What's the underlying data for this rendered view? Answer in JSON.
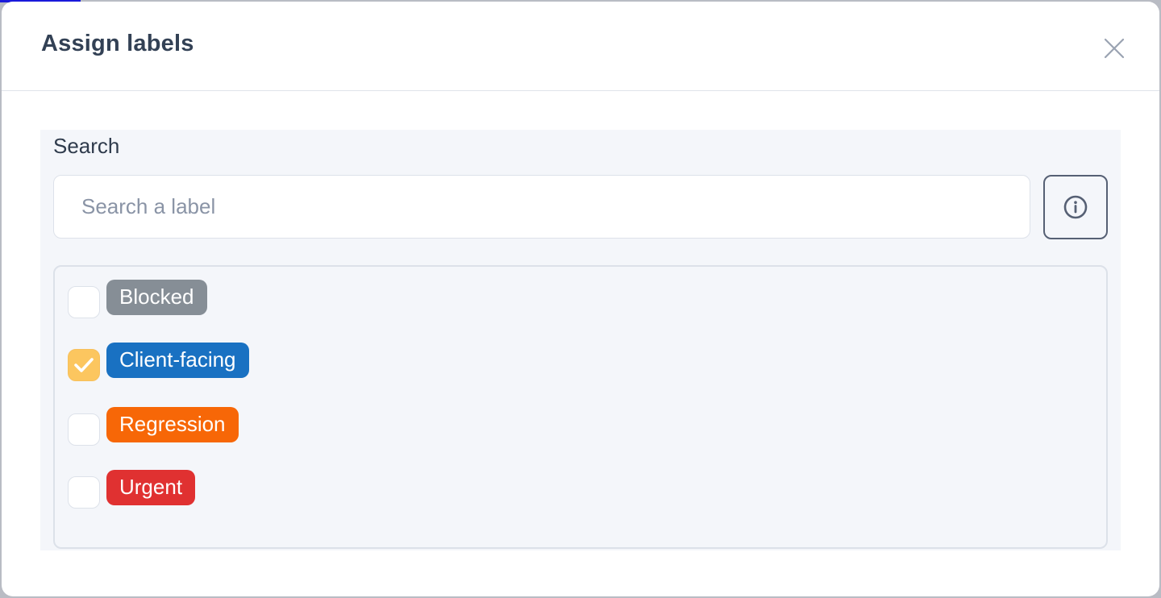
{
  "modal": {
    "title": "Assign labels"
  },
  "search": {
    "label": "Search",
    "placeholder": "Search a label",
    "value": ""
  },
  "labels": [
    {
      "name": "Blocked",
      "color": "#868e96",
      "checked": false
    },
    {
      "name": "Client-facing",
      "color": "#1971c2",
      "checked": true
    },
    {
      "name": "Regression",
      "color": "#f76707",
      "checked": false
    },
    {
      "name": "Urgent",
      "color": "#e03131",
      "checked": false
    }
  ],
  "icons": {
    "close": "close-icon",
    "info": "info-circle-icon",
    "check": "checkmark-icon"
  }
}
